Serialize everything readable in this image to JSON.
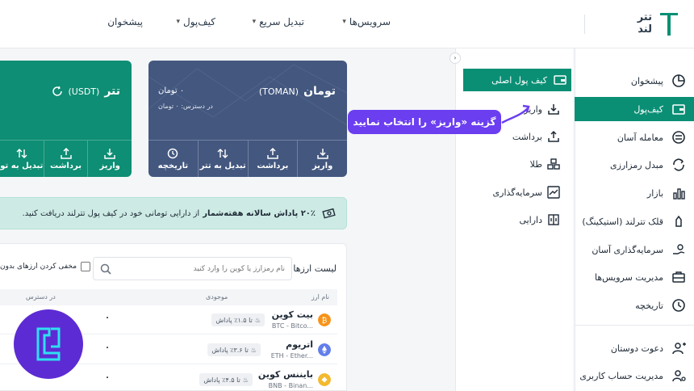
{
  "brand": {
    "logo_text": "تتر\nلند",
    "color": "#0a8f75"
  },
  "topnav": {
    "items": [
      {
        "label": "پیشخوان",
        "dropdown": false
      },
      {
        "label": "کیف‌پول",
        "dropdown": true
      },
      {
        "label": "تبدیل سریع",
        "dropdown": true
      },
      {
        "label": "سرویس‌ها",
        "dropdown": true
      }
    ]
  },
  "sidebar": {
    "items": [
      {
        "label": "پیشخوان",
        "icon": "chart-pie-icon",
        "active": false
      },
      {
        "label": "کیف‌پول",
        "icon": "wallet-icon",
        "active": true
      },
      {
        "label": "معامله آسان",
        "icon": "exchange-icon",
        "active": false
      },
      {
        "label": "مبدل رمزارزی",
        "icon": "converter-icon",
        "active": false
      },
      {
        "label": "بازار",
        "icon": "bar-chart-icon",
        "active": false
      },
      {
        "label": "قلک تترلند (استیکینگ)",
        "icon": "piggy-bank-icon",
        "active": false
      },
      {
        "label": "سرمایه‌گذاری آسان",
        "icon": "investment-icon",
        "active": false
      },
      {
        "label": "مدیریت سرویس‌ها",
        "icon": "briefcase-icon",
        "active": false
      },
      {
        "label": "تاریخچه",
        "icon": "history-icon",
        "active": false
      },
      {
        "label": "دعوت دوستان",
        "icon": "add-user-icon",
        "active": false
      },
      {
        "label": "مدیریت حساب کاربری",
        "icon": "user-settings-icon",
        "active": false
      }
    ]
  },
  "submenu": {
    "active_label": "کیف پول اصلی",
    "items": [
      {
        "label": "واریز",
        "icon": "deposit-icon"
      },
      {
        "label": "برداشت",
        "icon": "withdraw-icon"
      },
      {
        "label": "طلا",
        "icon": "gold-icon"
      },
      {
        "label": "سرمایه‌گذاری",
        "icon": "trend-icon"
      },
      {
        "label": "دارایی",
        "icon": "assets-icon"
      }
    ]
  },
  "tooltip": {
    "text": "گزینه «واریز» را انتخاب نمایید",
    "color": "#6b3ef0"
  },
  "cards": {
    "toman": {
      "title": "تومان",
      "code": "(TOMAN)",
      "balance": "۰ تومان",
      "available": "در دسترس: ۰ تومان",
      "actions": [
        "واریز",
        "برداشت",
        "تبدیل به تتر",
        "تاریخچه"
      ],
      "color": "#43577f"
    },
    "usdt": {
      "title": "تتر",
      "code": "(USDT)",
      "actions": [
        "واریز",
        "برداشت",
        "تبدیل به تو"
      ],
      "color": "#0e8e74"
    }
  },
  "banner": {
    "bold": "۲۰٪ پاداش سالانه هفته‌شمار",
    "text": "از دارایی تومانی خود در کیف پول تترلند دریافت کنید."
  },
  "assets": {
    "title": "لیست ارزها",
    "search_placeholder": "نام رمزارز یا کوین را وارد کنید",
    "hide_small_label": "مخفی کردن ارزهای بدون",
    "columns": {
      "name": "نام ارز",
      "balance": "موجودی",
      "available": "در دسترس"
    },
    "rows": [
      {
        "name": "بیت کوین",
        "symbol": "BTC - Bitco...",
        "reward": "تا ۱.۵٪ پاداش",
        "amount": "۰",
        "color": "#f7931a"
      },
      {
        "name": "اتریوم",
        "symbol": "ETH - Ether...",
        "reward": "تا ۳.۶٪ پاداش",
        "amount": "۰",
        "color": "#627eea"
      },
      {
        "name": "بایننس کوین",
        "symbol": "BNB - Binan...",
        "reward": "تا ۴.۵٪ پاداش",
        "amount": "۰",
        "color": "#f3ba2f"
      }
    ]
  }
}
